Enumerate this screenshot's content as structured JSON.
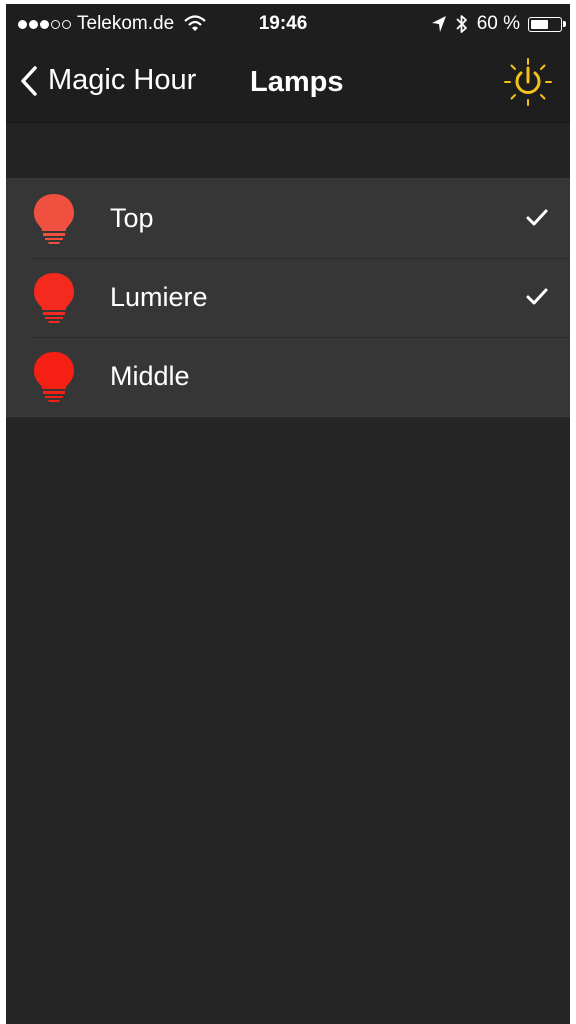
{
  "status_bar": {
    "carrier": "Telekom.de",
    "signal_bars_filled": 3,
    "signal_bars_total": 5,
    "time": "19:46",
    "battery_text": "60 %",
    "battery_level": 0.6,
    "icons": [
      "wifi-icon",
      "location-arrow-icon",
      "bluetooth-icon",
      "battery-icon"
    ]
  },
  "nav": {
    "back_label": "Magic Hour",
    "title": "Lamps",
    "power_icon": "power-icon",
    "power_color": "#f2c316"
  },
  "lamps": [
    {
      "name": "Top",
      "selected": true,
      "color": "#f05040"
    },
    {
      "name": "Lumiere",
      "selected": true,
      "color": "#f52a1e"
    },
    {
      "name": "Middle",
      "selected": false,
      "color": "#f51f14"
    }
  ],
  "colors": {
    "background": "#262626",
    "navbar": "#1e1e1e",
    "row": "#363636",
    "text": "#ffffff"
  }
}
